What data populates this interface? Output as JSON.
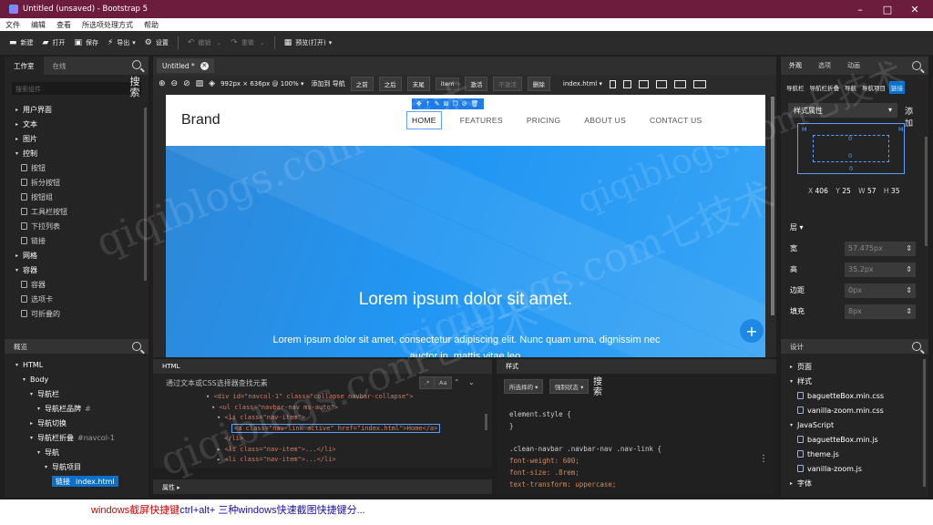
{
  "window": {
    "title": "Untitled (unsaved) - Bootstrap 5",
    "min": "–",
    "max": "□",
    "close": "✕"
  },
  "menu": [
    "文件",
    "编辑",
    "查看",
    "所选项处理方式",
    "帮助"
  ],
  "toolbar": {
    "new": "新建",
    "open": "打开",
    "save": "保存",
    "export": "导出",
    "settings": "设置",
    "undo": "撤销",
    "redo": "重做",
    "preview": "预览(打开)"
  },
  "left_panel": {
    "tabs": [
      "工作室",
      "在线"
    ],
    "search_placeholder": "搜索组件",
    "search_button": "搜索",
    "items": [
      {
        "label": "用户界面",
        "level": 0
      },
      {
        "label": "文本",
        "level": 0
      },
      {
        "label": "图片",
        "level": 0
      },
      {
        "label": "控制",
        "level": 0,
        "open": true
      },
      {
        "label": "按钮",
        "level": 1
      },
      {
        "label": "拆分按钮",
        "level": 1
      },
      {
        "label": "按钮组",
        "level": 1
      },
      {
        "label": "工具栏按钮",
        "level": 1
      },
      {
        "label": "下拉列表",
        "level": 1
      },
      {
        "label": "链接",
        "level": 1
      },
      {
        "label": "网格",
        "level": 0
      },
      {
        "label": "容器",
        "level": 0,
        "open": true
      },
      {
        "label": "容器",
        "level": 1
      },
      {
        "label": "选项卡",
        "level": 1
      },
      {
        "label": "可折叠的",
        "level": 1
      }
    ]
  },
  "overview": {
    "title": "概览",
    "items": [
      {
        "label": "HTML",
        "indent": 0
      },
      {
        "label": "Body",
        "indent": 1
      },
      {
        "label": "导航栏",
        "indent": 2
      },
      {
        "label": "导航栏品牌",
        "indent": 3,
        "extra": "#"
      },
      {
        "label": "导航切换",
        "indent": 2
      },
      {
        "label": "导航栏折叠",
        "indent": 2,
        "extra": "#navcol-1"
      },
      {
        "label": "导航",
        "indent": 3
      },
      {
        "label": "导航项目",
        "indent": 4
      },
      {
        "label": "链接",
        "indent": 5,
        "extra": "index.html",
        "selected": true
      }
    ]
  },
  "doc_tab": {
    "label": "Untitled *"
  },
  "canvas_toolbar": {
    "size": "992px × 636px @ 100% ▾",
    "add_nav": "添加到 导航",
    "before": "之前",
    "after": "之后",
    "end": "末尾",
    "item": "item",
    "enable": "激活",
    "disable": "不激活",
    "delete": "删除",
    "page": "index.html ▾"
  },
  "page": {
    "brand": "Brand",
    "nav_links": [
      "HOME",
      "FEATURES",
      "PRICING",
      "ABOUT US",
      "CONTACT US"
    ],
    "hero_title": "Lorem ipsum dolor sit amet.",
    "hero_text": "Lorem ipsum dolor sit amet, consectetur adipiscing elit. Nunc quam urna, dignissim nec auctor in, mattis vitae leo."
  },
  "html_panel": {
    "title": "HTML",
    "search_placeholder": "通过文本或CSS选择器查找元素",
    "aa": "Aa",
    "lines": [
      "<div id=\"navcol-1\" class=\"collapse navbar-collapse\">",
      "<ul class=\"navbar-nav ms-auto\">",
      "<li class=\"nav-item\">",
      "<a class=\"nav-link active\" href=\"index.html\">Home</a>",
      "</li>",
      "<li class=\"nav-item\">...</li>",
      "<li class=\"nav-item\">...</li>"
    ]
  },
  "attrs": {
    "label": "属性 ▸"
  },
  "styles_panel": {
    "title": "样式",
    "button_1": "所选择的 ▾",
    "button_2": "强制状态 ▾",
    "search": "搜索",
    "lines": [
      "element.style {",
      "}",
      "",
      ".clean-navbar .navbar-nav .nav-link {",
      "  font-weight: 600;",
      "  font-size: .8rem;",
      "  text-transform: uppercase;"
    ]
  },
  "right_panel": {
    "tabs": [
      "外观",
      "选项",
      "动画"
    ],
    "buttons": [
      "导航栏",
      "导航栏折叠",
      "导航",
      "导航项目",
      "链接"
    ],
    "style_dropdown": "样式属性",
    "add": "添加",
    "box_values": {
      "margin": "0",
      "padding": "0"
    },
    "xywh": {
      "X": "406",
      "Y": "25",
      "W": "57",
      "H": "35"
    },
    "layer": "层 ▾",
    "props": [
      {
        "label": "宽",
        "value": "57.475px"
      },
      {
        "label": "高",
        "value": "35.2px"
      },
      {
        "label": "边距",
        "value": "0px"
      },
      {
        "label": "填充",
        "value": "8px"
      }
    ]
  },
  "design_panel": {
    "title": "设计",
    "items": [
      {
        "label": "页面",
        "type": "group",
        "indent": 0
      },
      {
        "label": "样式",
        "type": "group",
        "indent": 0
      },
      {
        "label": "baguetteBox.min.css",
        "type": "file",
        "indent": 1
      },
      {
        "label": "vanilla-zoom.min.css",
        "type": "file",
        "indent": 1
      },
      {
        "label": "JavaScript",
        "type": "group",
        "indent": 0
      },
      {
        "label": "baguetteBox.min.js",
        "type": "file",
        "indent": 1
      },
      {
        "label": "theme.js",
        "type": "file",
        "indent": 1
      },
      {
        "label": "vanilla-zoom.js",
        "type": "file",
        "indent": 1
      },
      {
        "label": "字体",
        "type": "group",
        "indent": 0
      }
    ]
  },
  "bottom_link": {
    "part1": "windows截屏快捷键",
    "part2": "ctrl+alt+",
    "part3": "三种windows快速截图快捷键分..."
  },
  "watermark": "qiqiblogs.com七技术"
}
